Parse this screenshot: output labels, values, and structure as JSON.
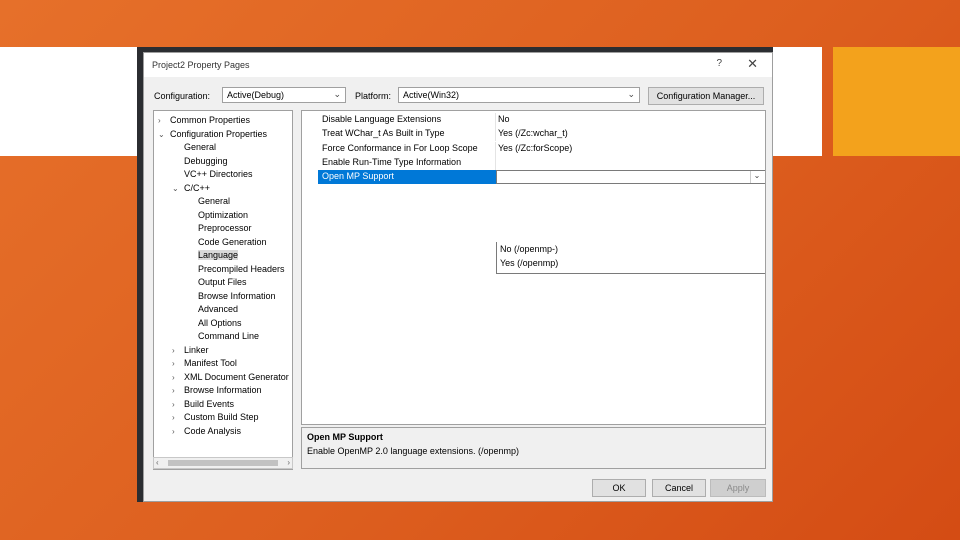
{
  "dialog": {
    "title": "Project2 Property Pages",
    "help_glyph": "?",
    "close_glyph": "✕"
  },
  "config_bar": {
    "configuration_label": "Configuration:",
    "configuration_value": "Active(Debug)",
    "platform_label": "Platform:",
    "platform_value": "Active(Win32)",
    "manager_button": "Configuration Manager..."
  },
  "tree": {
    "items": [
      {
        "label": "Common Properties",
        "level": 0,
        "expander": "›"
      },
      {
        "label": "Configuration Properties",
        "level": 0,
        "expander": "⌄"
      },
      {
        "label": "General",
        "level": 1,
        "expander": ""
      },
      {
        "label": "Debugging",
        "level": 1,
        "expander": ""
      },
      {
        "label": "VC++ Directories",
        "level": 1,
        "expander": ""
      },
      {
        "label": "C/C++",
        "level": 1,
        "expander": "⌄"
      },
      {
        "label": "General",
        "level": 2,
        "expander": ""
      },
      {
        "label": "Optimization",
        "level": 2,
        "expander": ""
      },
      {
        "label": "Preprocessor",
        "level": 2,
        "expander": ""
      },
      {
        "label": "Code Generation",
        "level": 2,
        "expander": ""
      },
      {
        "label": "Language",
        "level": 2,
        "expander": "",
        "selected": true
      },
      {
        "label": "Precompiled Headers",
        "level": 2,
        "expander": ""
      },
      {
        "label": "Output Files",
        "level": 2,
        "expander": ""
      },
      {
        "label": "Browse Information",
        "level": 2,
        "expander": ""
      },
      {
        "label": "Advanced",
        "level": 2,
        "expander": ""
      },
      {
        "label": "All Options",
        "level": 2,
        "expander": ""
      },
      {
        "label": "Command Line",
        "level": 2,
        "expander": ""
      },
      {
        "label": "Linker",
        "level": 1,
        "expander": "›"
      },
      {
        "label": "Manifest Tool",
        "level": 1,
        "expander": "›"
      },
      {
        "label": "XML Document Generator",
        "level": 1,
        "expander": "›"
      },
      {
        "label": "Browse Information",
        "level": 1,
        "expander": "›"
      },
      {
        "label": "Build Events",
        "level": 1,
        "expander": "›"
      },
      {
        "label": "Custom Build Step",
        "level": 1,
        "expander": "›"
      },
      {
        "label": "Code Analysis",
        "level": 1,
        "expander": "›"
      }
    ]
  },
  "properties": {
    "rows": [
      {
        "name": "Disable Language Extensions",
        "value": "No"
      },
      {
        "name": "Treat WChar_t As Built in Type",
        "value": "Yes (/Zc:wchar_t)"
      },
      {
        "name": "Force Conformance in For Loop Scope",
        "value": "Yes (/Zc:forScope)"
      },
      {
        "name": "Enable Run-Time Type Information",
        "value": ""
      },
      {
        "name": "Open MP Support",
        "value": "",
        "selected": true
      }
    ],
    "dropdown_options": [
      "No (/openmp-)",
      "Yes (/openmp)"
    ],
    "dropdown_arrow": "⌄"
  },
  "description": {
    "title": "Open MP Support",
    "text": "Enable OpenMP 2.0 language extensions.     (/openmp)"
  },
  "buttons": {
    "ok": "OK",
    "cancel": "Cancel",
    "apply": "Apply"
  },
  "colors": {
    "selection": "#0078d7",
    "slide_accent": "#f3a21c"
  }
}
